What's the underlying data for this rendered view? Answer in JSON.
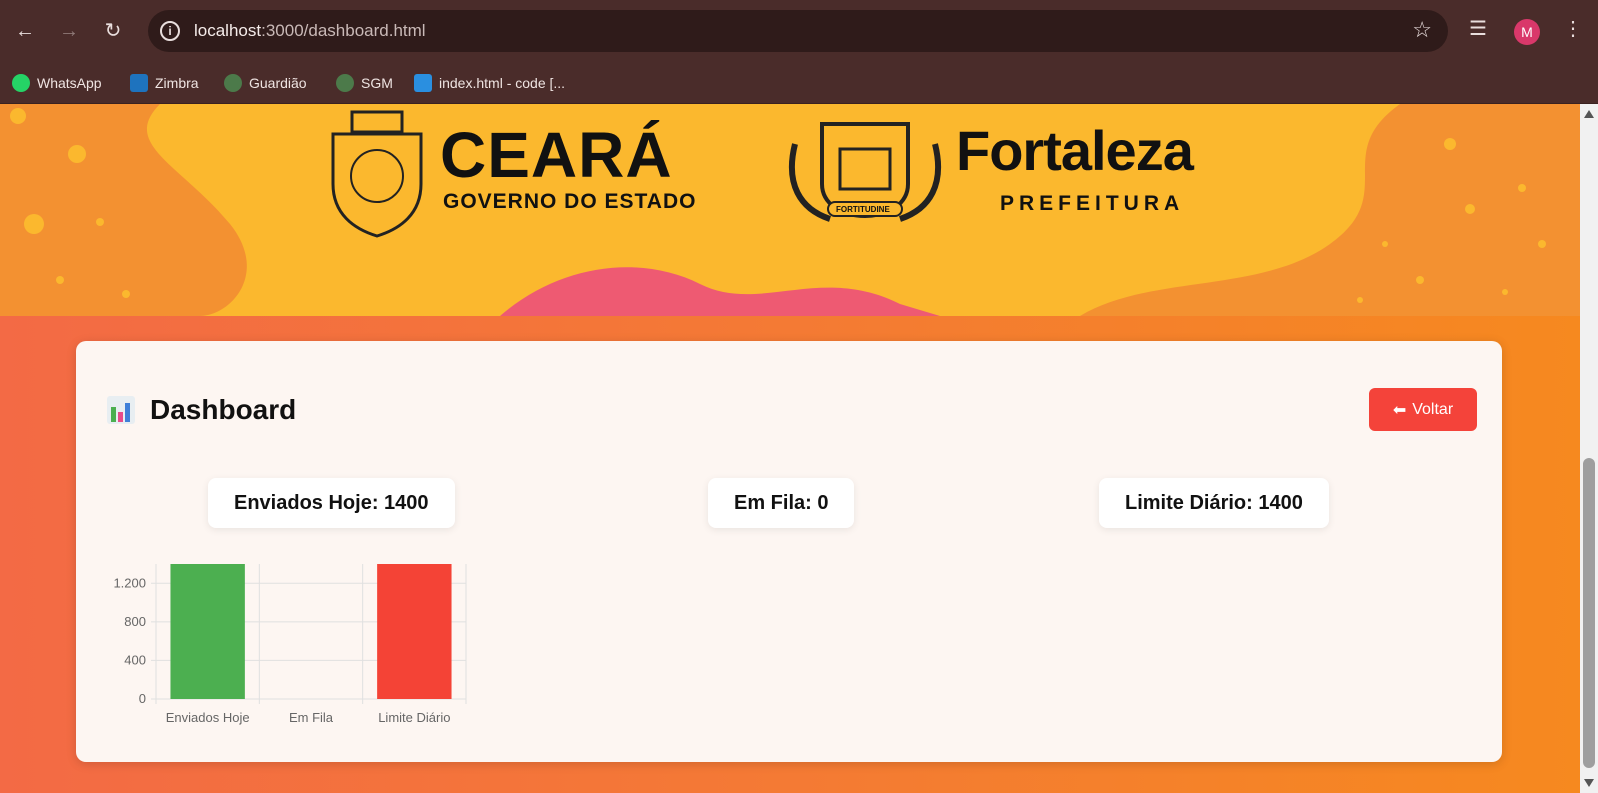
{
  "browser": {
    "url_host": "localhost",
    "url_path": ":3000/dashboard.html",
    "avatar_letter": "M",
    "bookmarks": [
      {
        "label": "WhatsApp",
        "icon": "whatsapp-icon",
        "color": "#25d366"
      },
      {
        "label": "Zimbra",
        "icon": "zimbra-icon",
        "color": "#1e73be"
      },
      {
        "label": "Guardião",
        "icon": "guardiao-icon",
        "color": "#4c7a4a"
      },
      {
        "label": "SGM",
        "icon": "sgm-icon",
        "color": "#4c7a4a"
      },
      {
        "label": "index.html - code [...",
        "icon": "vscode-icon",
        "color": "#2a8fe0"
      }
    ]
  },
  "banner": {
    "ceara_title": "CEARÁ",
    "ceara_subtitle": "GOVERNO DO ESTADO",
    "fortaleza_title": "Fortaleza",
    "fortaleza_subtitle": "PREFEITURA",
    "fortaleza_motto": "FORTITUDINE"
  },
  "dashboard": {
    "title": "Dashboard",
    "title_icon": "bar-chart-icon",
    "back_label": "Voltar",
    "back_icon": "arrow-left-icon",
    "stats": {
      "sent": "Enviados Hoje: 1400",
      "queue": "Em Fila: 0",
      "limit": "Limite Diário: 1400"
    }
  },
  "chart_data": {
    "type": "bar",
    "categories": [
      "Enviados Hoje",
      "Em Fila",
      "Limite Diário"
    ],
    "values": [
      1400,
      0,
      1400
    ],
    "colors": [
      "#4caf50",
      "#ffc107",
      "#f44336"
    ],
    "ylim": [
      0,
      1400
    ],
    "yticks": [
      "0",
      "400",
      "800",
      "1.200"
    ],
    "grid": true
  },
  "colors": {
    "accent_red": "#f4433a",
    "banner_yellow": "#fbb82e",
    "page_orange": "#f47a34"
  }
}
